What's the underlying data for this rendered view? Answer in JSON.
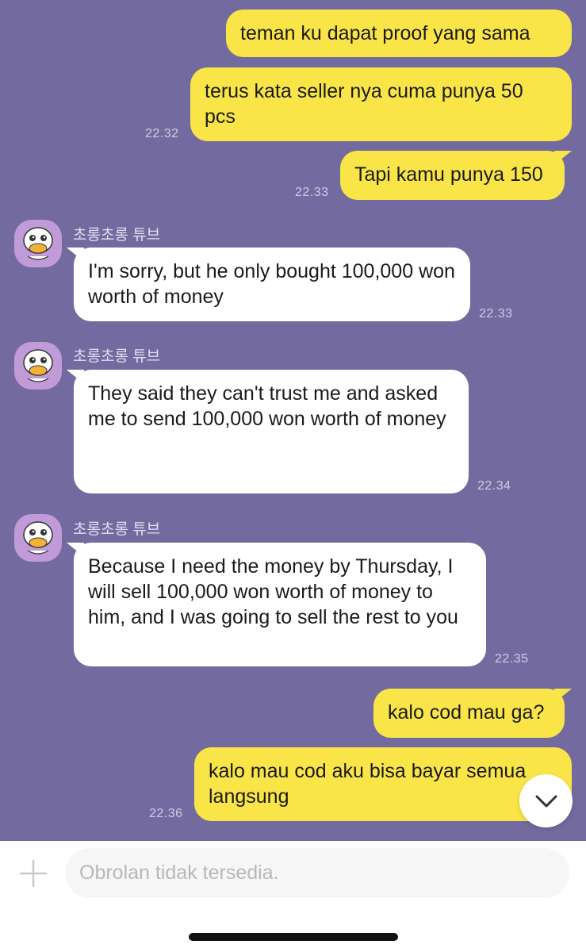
{
  "messages": [
    {
      "text": "teman ku dapat proof yang sama"
    },
    {
      "text": "terus kata seller nya cuma punya 50 pcs",
      "time": "22.32"
    },
    {
      "text": "Tapi kamu punya 150",
      "time": "22.33"
    },
    {
      "sender": "초롱초롱 튜브",
      "text": "I'm sorry, but he only bought 100,000 won worth of money",
      "time": "22.33"
    },
    {
      "sender": "초롱초롱 튜브",
      "text": "They said they can't trust me and asked me to send 100,000 won worth of money",
      "time": "22.34"
    },
    {
      "sender": "초롱초롱 튜브",
      "text": "Because I need the money by Thursday, I will sell 100,000 won worth of money to him, and I was going to sell the rest to you",
      "time": "22.35"
    },
    {
      "text": "kalo cod mau ga?"
    },
    {
      "text": "kalo mau cod aku bisa bayar semua langsung",
      "time": "22.36"
    }
  ],
  "input": {
    "placeholder": "Obrolan tidak tersedia."
  },
  "icons": {
    "scroll": "chevron-down-icon",
    "add": "plus-icon",
    "avatar": "tube-character-avatar"
  }
}
